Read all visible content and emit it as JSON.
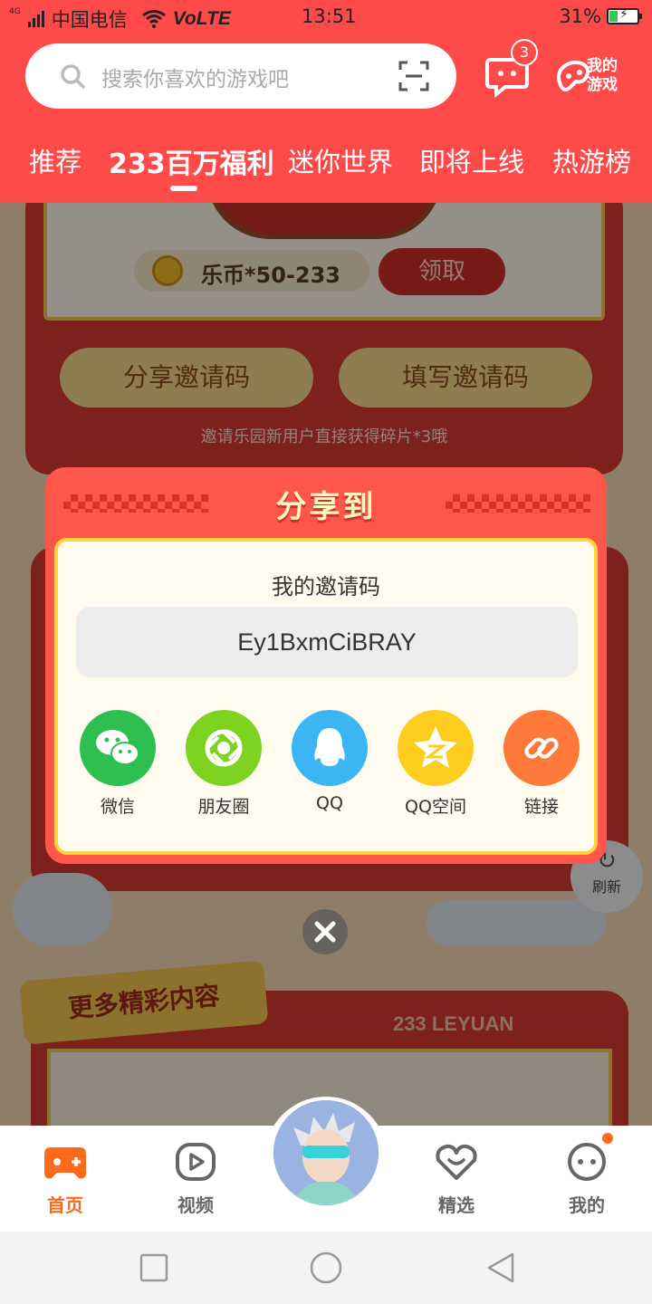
{
  "status_bar": {
    "network": "4G",
    "carrier": "中国电信",
    "volte": "VoLTE",
    "time": "13:51",
    "battery_percent": "31%",
    "battery_level": 0.31
  },
  "header": {
    "search_placeholder": "搜索你喜欢的游戏吧",
    "message_badge_count": "3",
    "my_games_label": "我的游戏"
  },
  "tabs": [
    {
      "label": "推荐",
      "active": false
    },
    {
      "label": "233百万福利",
      "active": true
    },
    {
      "label": "迷你世界",
      "active": false
    },
    {
      "label": "即将上线",
      "active": false
    },
    {
      "label": "热游榜",
      "active": false
    }
  ],
  "background_content": {
    "coin_reward": "乐币*50-233",
    "claim_button": "领取",
    "share_invite_button": "分享邀请码",
    "enter_invite_button": "填写邀请码",
    "invite_tip": "邀请乐园新用户直接获得碎片*3哦",
    "refresh_label": "刷新",
    "more_content_title": "更多精彩内容",
    "leyuan_label": "233 LEYUAN"
  },
  "share_modal": {
    "title": "分享到",
    "code_title": "我的邀请码",
    "invite_code": "Ey1BxmCiBRAY",
    "options": [
      {
        "label": "微信",
        "icon": "wechat-icon",
        "color": "#2dc050"
      },
      {
        "label": "朋友圈",
        "icon": "moments-icon",
        "color": "#7ed321"
      },
      {
        "label": "QQ",
        "icon": "qq-icon",
        "color": "#3cb5f5"
      },
      {
        "label": "QQ空间",
        "icon": "qzone-icon",
        "color": "#ffcc20"
      },
      {
        "label": "链接",
        "icon": "link-icon",
        "color": "#ff7a3a"
      }
    ]
  },
  "bottom_nav": {
    "items": [
      {
        "label": "首页",
        "icon": "gamepad-icon",
        "active": true
      },
      {
        "label": "视频",
        "icon": "video-icon",
        "active": false
      },
      {
        "label": "精选",
        "icon": "heart-icon",
        "active": false
      },
      {
        "label": "我的",
        "icon": "face-icon",
        "active": false,
        "dot_badge": true
      }
    ]
  },
  "colors": {
    "brand_red": "#ff4a4a",
    "active_orange": "#ff6a1a",
    "modal_red": "#ff564a"
  }
}
